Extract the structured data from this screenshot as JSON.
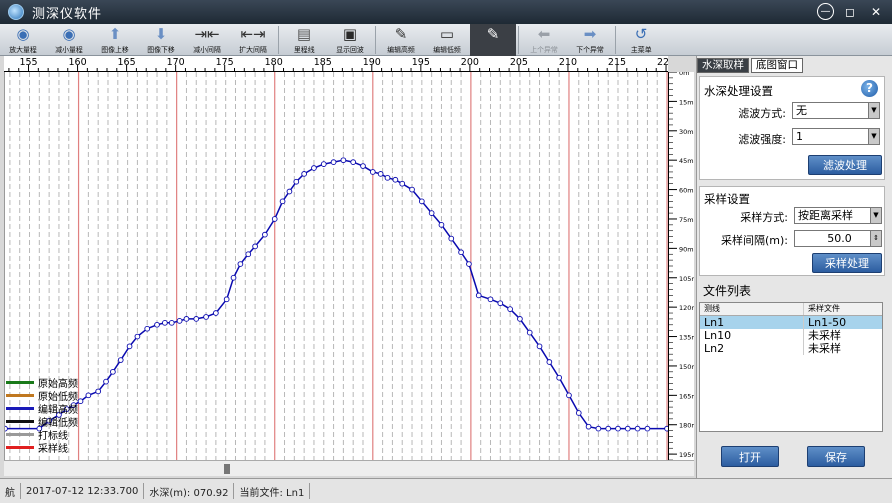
{
  "window": {
    "title": "测深仪软件"
  },
  "toolbar": {
    "buttons": [
      {
        "label": "放大量程",
        "icon": "zoom-in-icon"
      },
      {
        "label": "减小量程",
        "icon": "zoom-out-icon"
      },
      {
        "label": "图像上移",
        "icon": "arrow-up-icon"
      },
      {
        "label": "图像下移",
        "icon": "arrow-down-icon"
      },
      {
        "label": "减小间隔",
        "icon": "narrow-interval-icon"
      },
      {
        "label": "扩大间隔",
        "icon": "widen-interval-icon"
      },
      {
        "label": "里程线",
        "icon": "mileage-line-icon"
      },
      {
        "label": "显示回波",
        "icon": "echo-display-icon"
      },
      {
        "label": "编辑高频",
        "icon": "edit-high-freq-icon"
      },
      {
        "label": "编辑低频",
        "icon": "edit-low-freq-icon"
      },
      {
        "label": "",
        "icon": "pen-edit-icon"
      },
      {
        "label": "上个异常",
        "icon": "prev-anomaly-icon"
      },
      {
        "label": "下个异常",
        "icon": "next-anomaly-icon"
      },
      {
        "label": "主菜单",
        "icon": "main-menu-icon"
      }
    ]
  },
  "chart_data": {
    "type": "line",
    "x_ticks": [
      155,
      160,
      165,
      170,
      175,
      180,
      185,
      190,
      195,
      200,
      205,
      210,
      215,
      220
    ],
    "x_ticks_display": [
      "155",
      "160",
      "165",
      "170",
      "175",
      "180",
      "185",
      "190",
      "195",
      "200",
      "205",
      "210",
      "215",
      "220"
    ],
    "xlim": [
      152.5,
      220.2
    ],
    "y_ticks": [
      0,
      15,
      30,
      45,
      60,
      75,
      90,
      105,
      120,
      135,
      150,
      165,
      180,
      195
    ],
    "y_tick_labels": [
      "0m",
      "15m",
      "30m",
      "45m",
      "60m",
      "75m",
      "90m",
      "105m",
      "120m",
      "135m",
      "150m",
      "165m",
      "180m",
      "195m"
    ],
    "ylim": [
      0,
      198
    ],
    "red_vertical_lines": [
      160,
      170,
      180,
      190,
      200,
      210,
      220
    ],
    "series": [
      {
        "name": "编辑高频",
        "color": "#0a0ab0",
        "x": [
          152.5,
          156,
          157,
          158,
          158.8,
          159.5,
          160.2,
          161,
          162,
          162.8,
          163.5,
          164.3,
          165.2,
          166,
          167,
          168,
          168.8,
          169.5,
          170.3,
          171,
          172,
          173,
          174,
          175.1,
          175.8,
          176.5,
          177.3,
          178,
          179,
          180,
          180.8,
          181.5,
          182.2,
          183,
          184,
          185,
          186,
          187,
          188,
          189,
          190,
          190.8,
          191.5,
          192.3,
          193,
          194,
          195,
          196,
          197,
          198,
          199,
          199.8,
          200.8,
          202,
          203,
          204,
          205,
          206,
          207,
          208,
          209,
          210,
          211,
          212,
          213,
          214,
          215,
          216,
          217,
          218,
          220
        ],
        "y": [
          182,
          182,
          178,
          175,
          172,
          170,
          168,
          165,
          163,
          158,
          153,
          147,
          140,
          135,
          131,
          129,
          128,
          128,
          127,
          126,
          126,
          125,
          123,
          116,
          105,
          98,
          93,
          89,
          83,
          75,
          66,
          61,
          56,
          52,
          49,
          47,
          46,
          45,
          46,
          48,
          51,
          52,
          54,
          55,
          57,
          60,
          66,
          72,
          78,
          85,
          92,
          98,
          114,
          116,
          118,
          121,
          126,
          133,
          140,
          148,
          156,
          165,
          174,
          181,
          182,
          182,
          182,
          182,
          182,
          182,
          182
        ]
      }
    ],
    "legend": [
      {
        "label": "原始高频",
        "color": "#1a7a1a"
      },
      {
        "label": "原始低频",
        "color": "#c07820"
      },
      {
        "label": "编辑高频",
        "color": "#1a1ab8"
      },
      {
        "label": "编辑低频",
        "color": "#111111"
      },
      {
        "label": "打标线",
        "color": "#9a9a9a"
      },
      {
        "label": "采样线",
        "color": "#e02020"
      }
    ]
  },
  "sidepanel": {
    "tabs": [
      "水深取样",
      "底图窗口"
    ],
    "filter": {
      "title": "水深处理设置",
      "method_label": "滤波方式:",
      "method_value": "无",
      "strength_label": "滤波强度:",
      "strength_value": "1",
      "button": "滤波处理"
    },
    "sampling": {
      "title": "采样设置",
      "method_label": "采样方式:",
      "method_value": "按距离采样",
      "interval_label": "采样间隔(m):",
      "interval_value": "50.0",
      "button": "采样处理"
    },
    "files": {
      "title": "文件列表",
      "headers": [
        "测线",
        "采样文件"
      ],
      "rows": [
        {
          "name": "Ln1",
          "sample": "Ln1-50"
        },
        {
          "name": "Ln10",
          "sample": "未采样"
        },
        {
          "name": "Ln2",
          "sample": "未采样"
        }
      ]
    },
    "open_button": "打开",
    "save_button": "保存"
  },
  "status": {
    "seg1": "航",
    "seg2": "2017-07-12 12:33.700",
    "seg3": "水深(m): 070.92",
    "seg4": "当前文件: Ln1"
  },
  "colors": {
    "accent": "#2c5da0",
    "titlebar": "#2a3642"
  }
}
